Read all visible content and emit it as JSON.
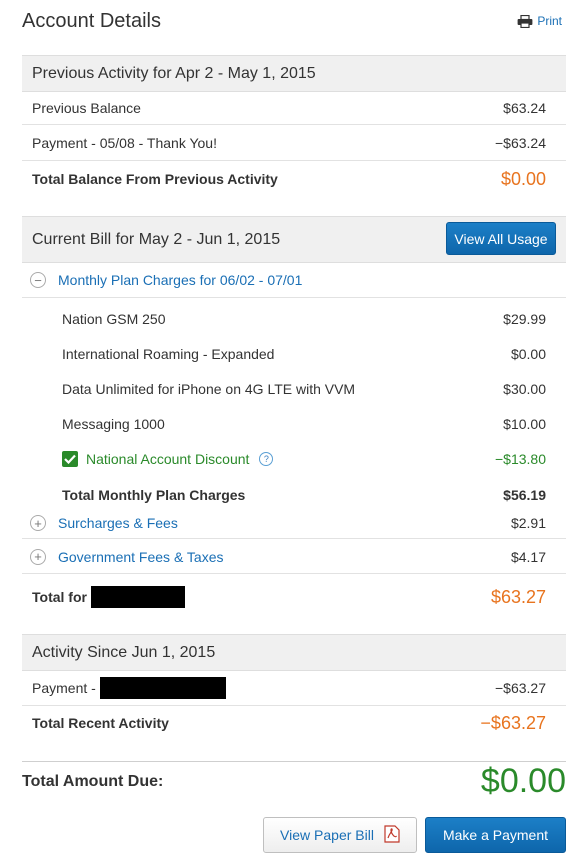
{
  "header": {
    "title": "Account Details",
    "print_label": "Print"
  },
  "previous": {
    "heading": "Previous Activity for Apr 2 - May 1, 2015",
    "rows": [
      {
        "label": "Previous Balance",
        "amount": "$63.24"
      },
      {
        "label": "Payment - 05/08 - Thank You!",
        "amount": "−$63.24"
      }
    ],
    "total_label": "Total Balance From Previous Activity",
    "total_amount": "$0.00"
  },
  "current": {
    "heading": "Current Bill for May 2 - Jun 1, 2015",
    "view_usage_label": "View All Usage",
    "monthly_plan_label": "Monthly Plan Charges for 06/02 - 07/01",
    "plan_items": [
      {
        "label": "Nation GSM 250",
        "amount": "$29.99"
      },
      {
        "label": "International Roaming - Expanded",
        "amount": "$0.00"
      },
      {
        "label": "Data Unlimited for iPhone on 4G LTE with VVM",
        "amount": "$30.00"
      },
      {
        "label": "Messaging 1000",
        "amount": "$10.00"
      }
    ],
    "discount_label": "National Account Discount",
    "discount_amount": "−$13.80",
    "total_plan_label": "Total Monthly Plan Charges",
    "total_plan_amount": "$56.19",
    "surcharges_label": "Surcharges & Fees",
    "surcharges_amount": "$2.91",
    "gov_label": "Government Fees & Taxes",
    "gov_amount": "$4.17",
    "total_for_label": "Total for",
    "total_for_amount": "$63.27"
  },
  "since": {
    "heading": "Activity Since Jun 1, 2015",
    "payment_label": "Payment -",
    "payment_amount": "−$63.27",
    "total_label": "Total Recent Activity",
    "total_amount": "−$63.27"
  },
  "due": {
    "label": "Total Amount Due:",
    "amount": "$0.00"
  },
  "actions": {
    "paper_bill_label": "View Paper Bill",
    "payment_label": "Make a Payment"
  },
  "colors": {
    "accent_blue": "#1a6fb5",
    "orange": "#e8741f",
    "green": "#2a8a2a"
  }
}
